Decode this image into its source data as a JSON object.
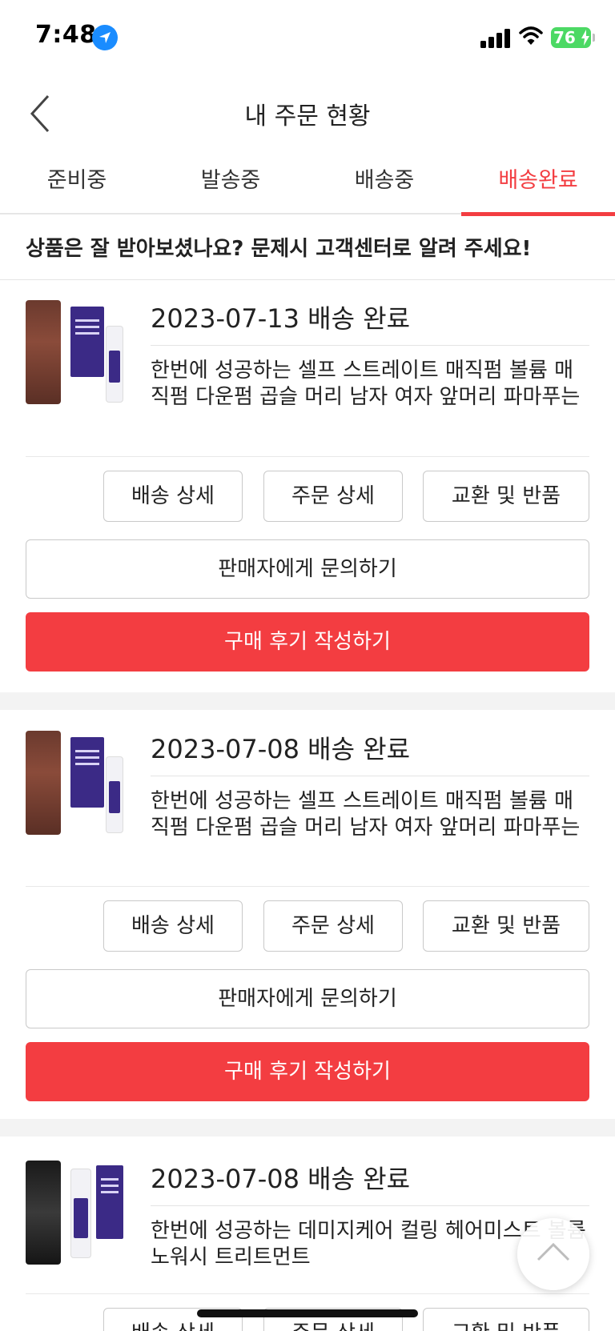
{
  "status_bar": {
    "time": "7:48",
    "battery": "76",
    "icons": [
      "location-arrow-icon",
      "signal-icon",
      "wifi-icon",
      "battery-icon"
    ]
  },
  "header": {
    "title": "내 주문 현황",
    "back_icon": "chevron-left-icon"
  },
  "tabs": [
    {
      "label": "준비중",
      "active": false
    },
    {
      "label": "발송중",
      "active": false
    },
    {
      "label": "배송중",
      "active": false
    },
    {
      "label": "배송완료",
      "active": true
    }
  ],
  "notice": "상품은 잘 받아보셨나요? 문제시 고객센터로 알려 주세요!",
  "orders": [
    {
      "date_status": "2023-07-13 배송 완료",
      "product": "한번에 성공하는 셀프 스트레이트 매직펌 볼륨 매직펌 다운펌 곱슬 머리 남자 여자 앞머리 파마푸는",
      "buttons": [
        "배송 상세",
        "주문 상세",
        "교환 및 반품"
      ],
      "contact_seller": "판매자에게 문의하기",
      "write_review": "구매 후기 작성하기"
    },
    {
      "date_status": "2023-07-08 배송 완료",
      "product": "한번에 성공하는 셀프 스트레이트 매직펌 볼륨 매직펌 다운펌 곱슬 머리 남자 여자 앞머리 파마푸는",
      "buttons": [
        "배송 상세",
        "주문 상세",
        "교환 및 반품"
      ],
      "contact_seller": "판매자에게 문의하기",
      "write_review": "구매 후기 작성하기"
    },
    {
      "date_status": "2023-07-08 배송 완료",
      "product": "한번에 성공하는 데미지케어 컬링 헤어미스트 볼륨 노워시 트리트먼트",
      "buttons": [
        "배송 상세",
        "주문 상세",
        "교환 및 반품"
      ]
    }
  ],
  "colors": {
    "accent": "#f33d41",
    "divider": "#e4e4e4",
    "section_gap": "#f3f3f3"
  },
  "scroll_top_icon": "chevron-up-icon"
}
